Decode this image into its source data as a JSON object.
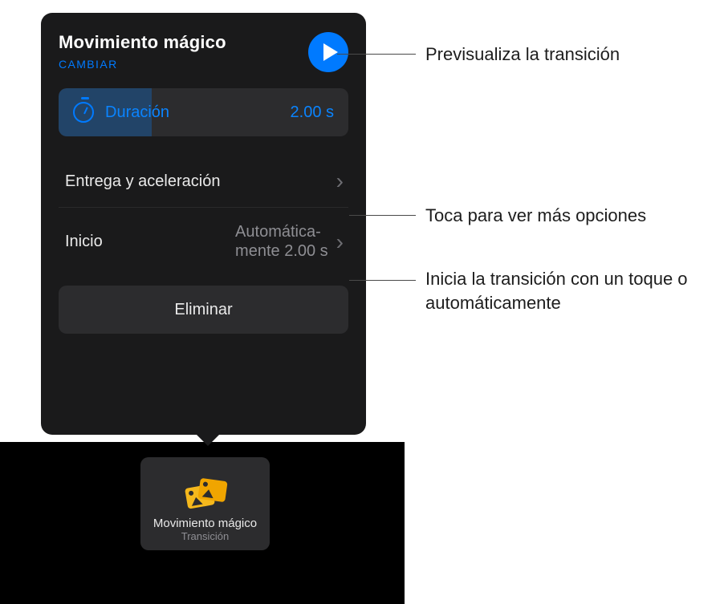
{
  "panel": {
    "title": "Movimiento mágico",
    "change": "CAMBIAR",
    "duration_label": "Duración",
    "duration_value": "2.00 s",
    "delivery_label": "Entrega y aceleración",
    "start_label": "Inicio",
    "start_value": "Automática-\nmente  2.00 s",
    "delete_label": "Eliminar"
  },
  "thumbnail": {
    "title": "Movimiento mágico",
    "subtitle": "Transición"
  },
  "callouts": {
    "preview": "Previsualiza la transición",
    "more": "Toca para ver más opciones",
    "start": "Inicia la transición con un toque o automáticamente"
  }
}
